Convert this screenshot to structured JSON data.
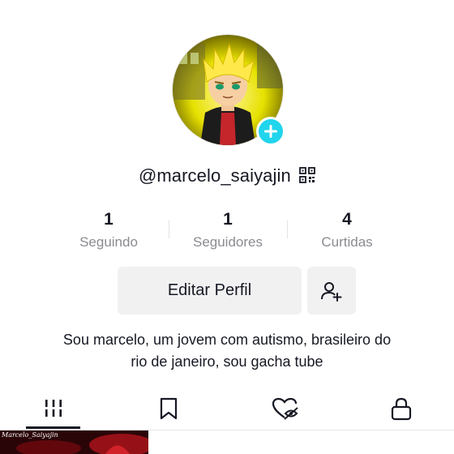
{
  "profile": {
    "username": "@marcelo_saiyajin",
    "bio_line1": "Sou marcelo, um jovem com autismo, brasileiro do",
    "bio_line2": "rio de janeiro, sou gacha tube"
  },
  "stats": [
    {
      "value": "1",
      "label": "Seguindo"
    },
    {
      "value": "1",
      "label": "Seguidores"
    },
    {
      "value": "4",
      "label": "Curtidas"
    }
  ],
  "buttons": {
    "edit_profile": "Editar Perfil"
  },
  "tabs": [
    {
      "icon": "grid-icon",
      "active": true
    },
    {
      "icon": "bookmark-icon",
      "active": false
    },
    {
      "icon": "liked-heart-icon",
      "active": false
    },
    {
      "icon": "lock-icon",
      "active": false
    }
  ],
  "videos": [
    {
      "caption": "Marcelo_Saiyajin"
    }
  ],
  "colors": {
    "accent": "#20d5ec",
    "text": "#161823",
    "muted": "#8a8b91",
    "button_bg": "#f1f1f2"
  }
}
